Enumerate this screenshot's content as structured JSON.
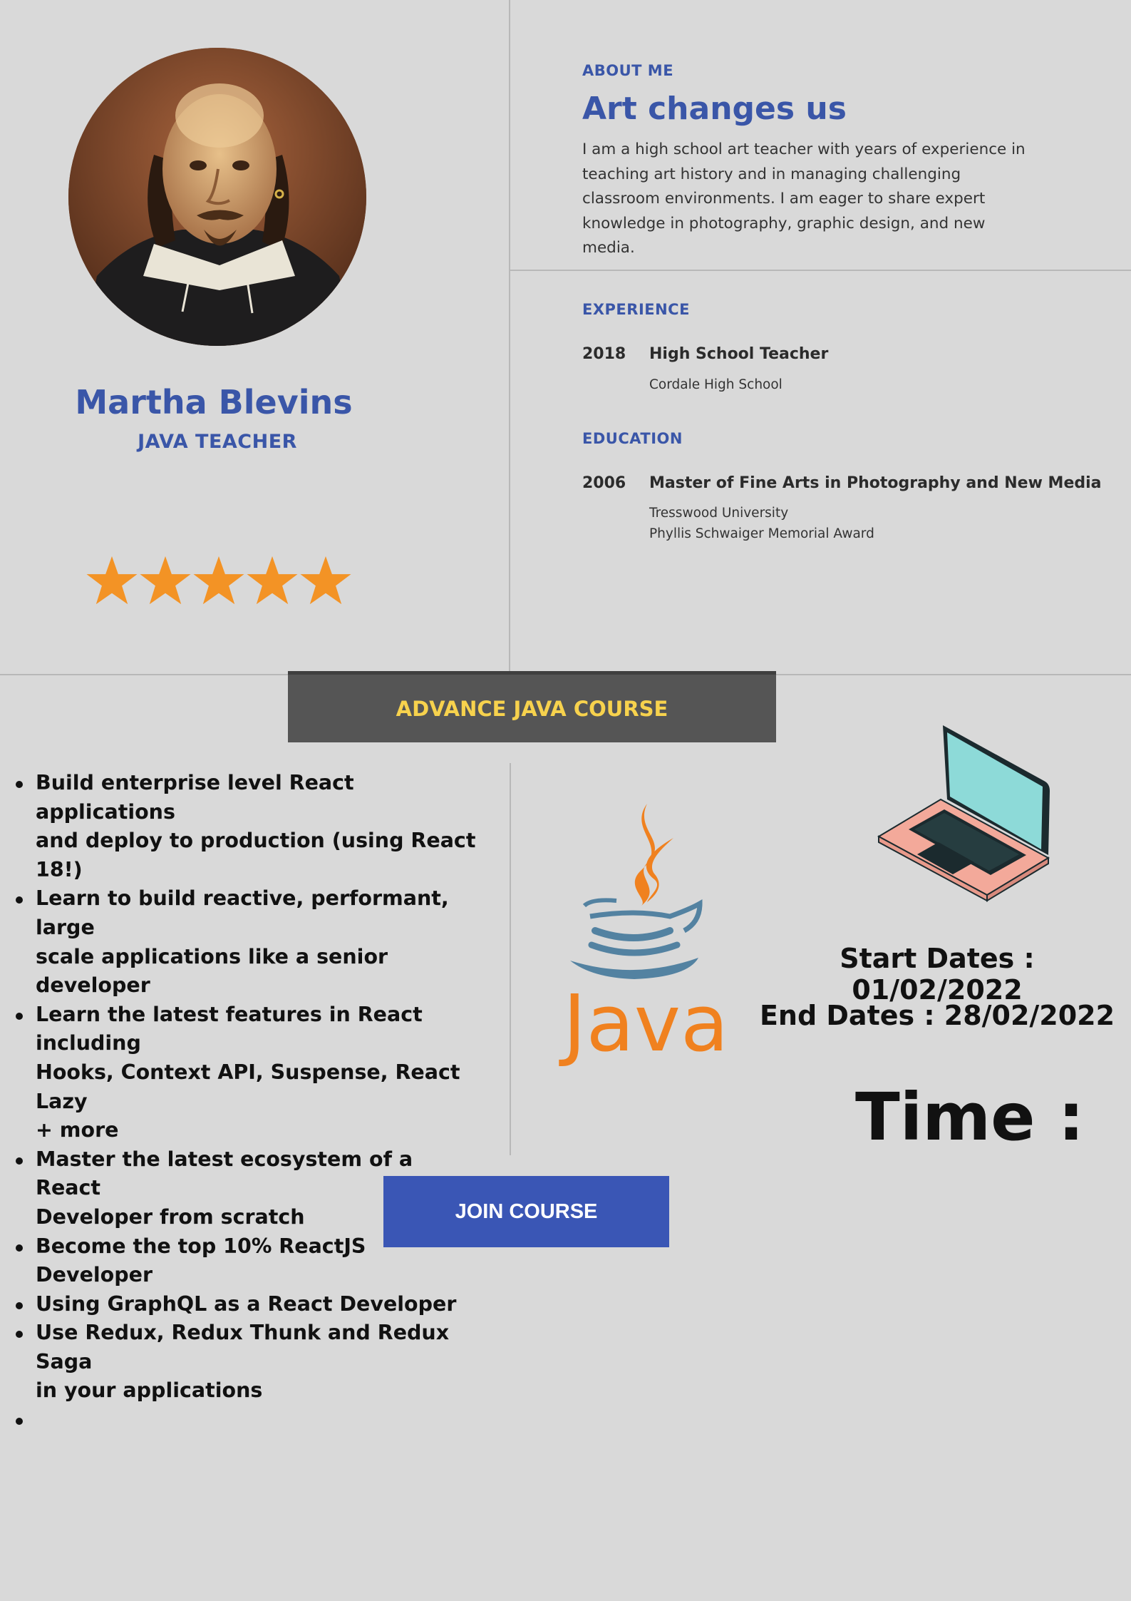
{
  "profile": {
    "name": "Martha Blevins",
    "role": "JAVA TEACHER",
    "rating": 5,
    "rating_max": 5
  },
  "about": {
    "label": "ABOUT ME",
    "headline": "Art changes us",
    "text": "I am a high school art teacher with years of experience in teaching art history and in managing challenging classroom environments. I am eager to share expert knowledge in photography, graphic design, and new media."
  },
  "experience": {
    "label": "EXPERIENCE",
    "items": [
      {
        "year": "2018",
        "title": "High School Teacher",
        "lines": [
          "Cordale High School"
        ]
      }
    ]
  },
  "education": {
    "label": "EDUCATION",
    "items": [
      {
        "year": "2006",
        "title": "Master of Fine Arts in Photography and New Media",
        "lines": [
          "Tresswood University",
          "Phyllis Schwaiger Memorial Award"
        ]
      }
    ]
  },
  "course": {
    "banner": "ADVANCE JAVA COURSE",
    "bullets": [
      [
        "Build enterprise level React applications",
        "and deploy to production (using React 18!)"
      ],
      [
        "Learn to build reactive, performant, large",
        "scale applications like a senior developer"
      ],
      [
        "Learn the latest features in React including",
        "Hooks, Context API, Suspense, React Lazy",
        "+ more"
      ],
      [
        "Master the latest ecosystem of a React",
        "Developer from scratch"
      ],
      [
        "Become the top 10% ReactJS Developer"
      ],
      [
        "Using GraphQL as a React Developer"
      ],
      [
        "Use Redux, Redux Thunk and Redux Saga",
        "in your applications"
      ],
      [
        ""
      ]
    ],
    "java_logo_text": "Java",
    "start_dates": "Start Dates : 01/02/2022",
    "end_dates": "End Dates : 28/02/2022",
    "time_label": "Time :",
    "join_label": "JOIN COURSE"
  },
  "colors": {
    "background": "#d9d9d9",
    "accent_blue": "#3a56a8",
    "banner_bg": "#555555",
    "banner_text": "#f7d24d",
    "star": "#f39325",
    "java_orange": "#f0811f",
    "java_blue": "#5382a1"
  },
  "icons": [
    "portrait-photo",
    "star-icon",
    "java-logo",
    "laptop-icon"
  ]
}
